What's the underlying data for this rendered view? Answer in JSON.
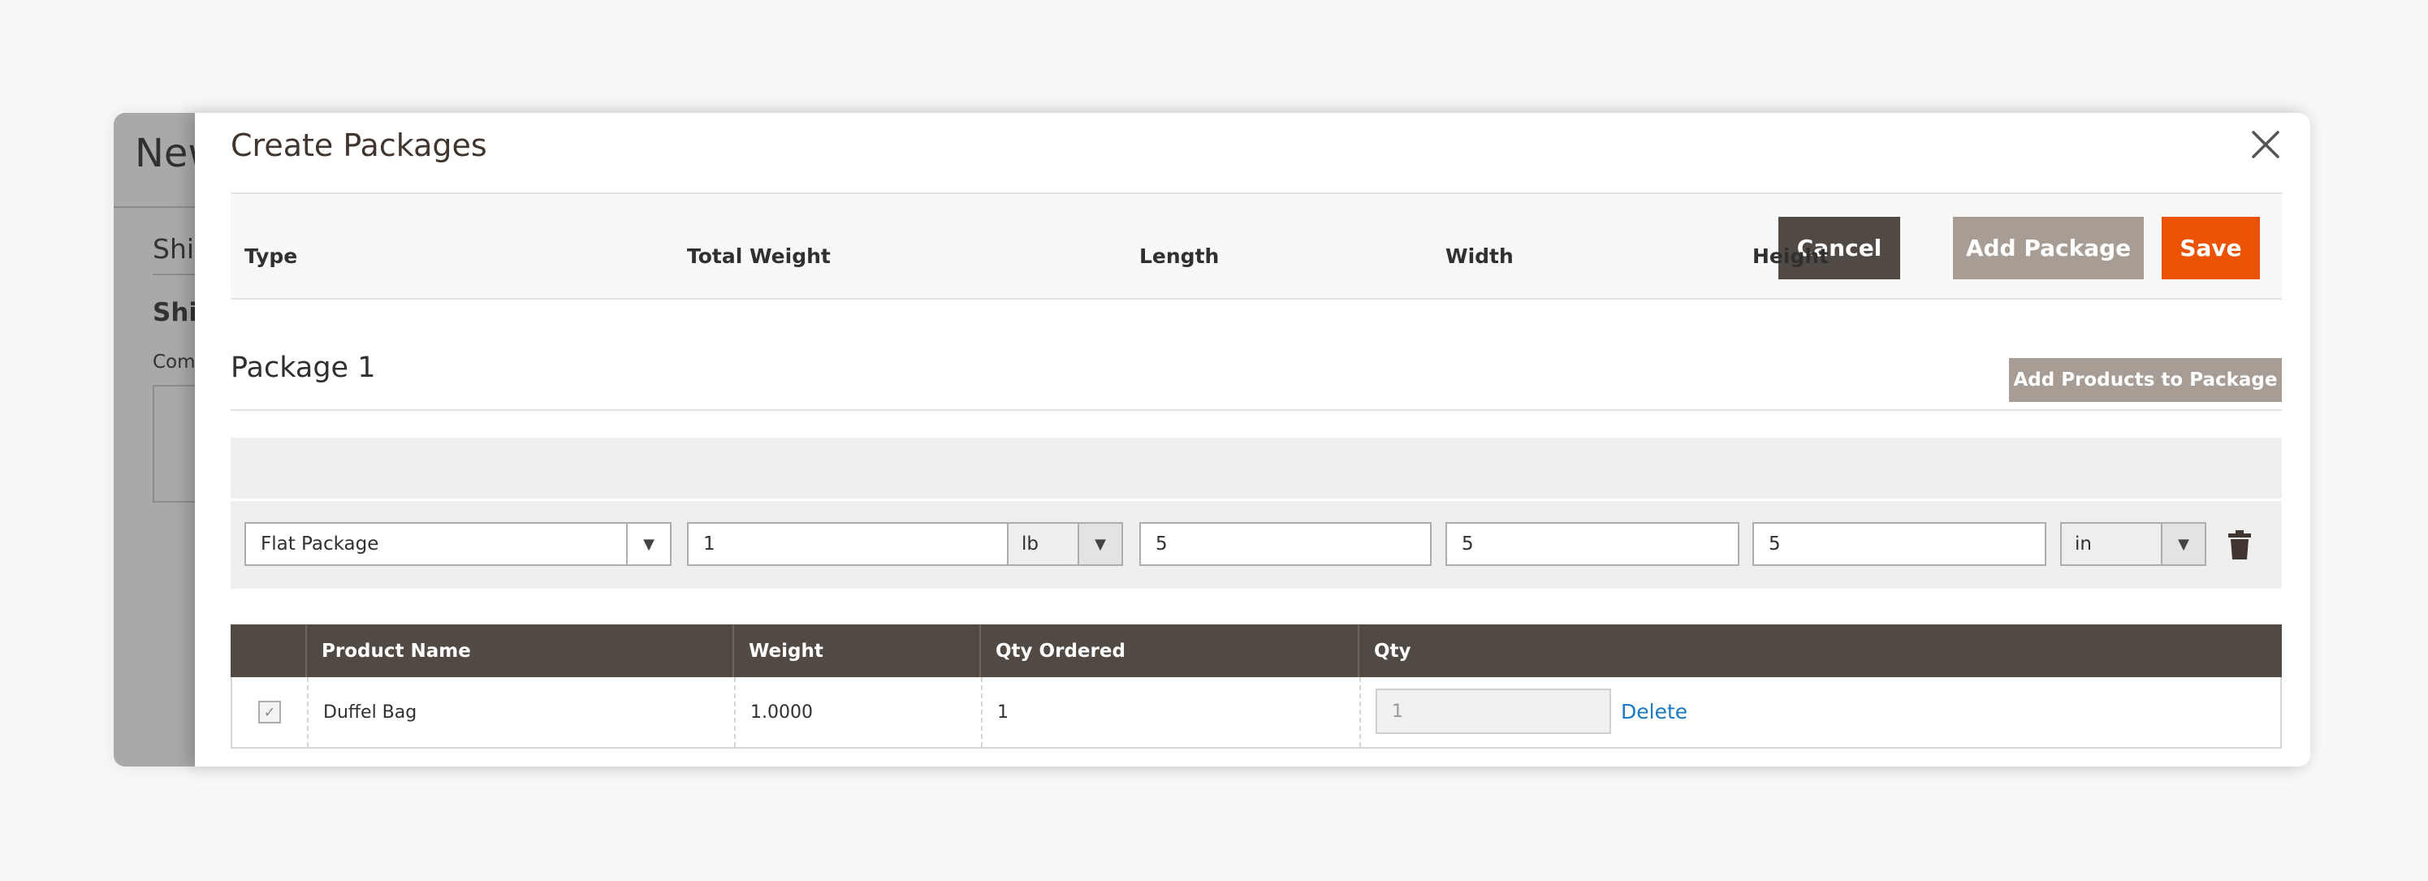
{
  "background_page": {
    "title": "New",
    "section_title": "Shi",
    "sub_title": "Ship",
    "comment_label": "Com"
  },
  "modal": {
    "title": "Create Packages",
    "close_icon": "close-icon"
  },
  "toolbar": {
    "cancel_label": "Cancel",
    "add_package_label": "Add Package",
    "save_label": "Save"
  },
  "package": {
    "title": "Package 1",
    "add_products_label": "Add Products to Package",
    "labels": {
      "type": "Type",
      "total_weight": "Total Weight",
      "length": "Length",
      "width": "Width",
      "height": "Height"
    },
    "values": {
      "type": "Flat Package",
      "total_weight": "1",
      "weight_unit": "lb",
      "length": "5",
      "width": "5",
      "height": "5",
      "dimension_unit": "in"
    },
    "delete_icon": "trash-icon"
  },
  "grid": {
    "columns": [
      "Product Name",
      "Weight",
      "Qty Ordered",
      "Qty"
    ],
    "rows": [
      {
        "checked": true,
        "product_name": "Duffel Bag",
        "weight": "1.0000",
        "qty_ordered": "1",
        "qty": "1",
        "delete_label": "Delete"
      }
    ]
  },
  "colors": {
    "primary_dark": "#514943",
    "secondary": "#a79d95",
    "accent": "#eb5202",
    "link": "#1979c3"
  }
}
